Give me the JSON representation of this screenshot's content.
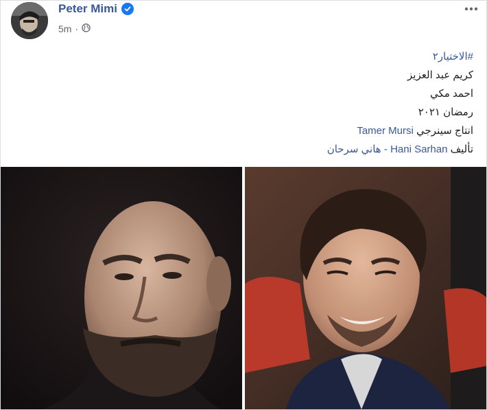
{
  "post": {
    "author": "Peter Mimi",
    "timestamp": "5m",
    "separator": "·",
    "audience_icon": "globe-icon",
    "verified_icon": "verified-badge-icon",
    "more_icon": "more-options-icon"
  },
  "text": {
    "hashtag": "#الاختيار٢",
    "line2": "كريم عبد العزيز",
    "line3": "احمد مكي",
    "line4": "رمضان ٢٠٢١",
    "line5_prefix": "انتاج سينرجي",
    "line5_name": "Tamer Mursi",
    "line6_prefix": "تأليف",
    "line6_name": "Hani Sarhan",
    "line6_suffix": "- هاني سرحان"
  },
  "photos": [
    {
      "name": "portrait-bald-bearded-man"
    },
    {
      "name": "portrait-smiling-man"
    }
  ],
  "colors": {
    "link": "#385898",
    "text": "#1c1e21",
    "meta": "#606770",
    "verified": "#1877f2"
  }
}
